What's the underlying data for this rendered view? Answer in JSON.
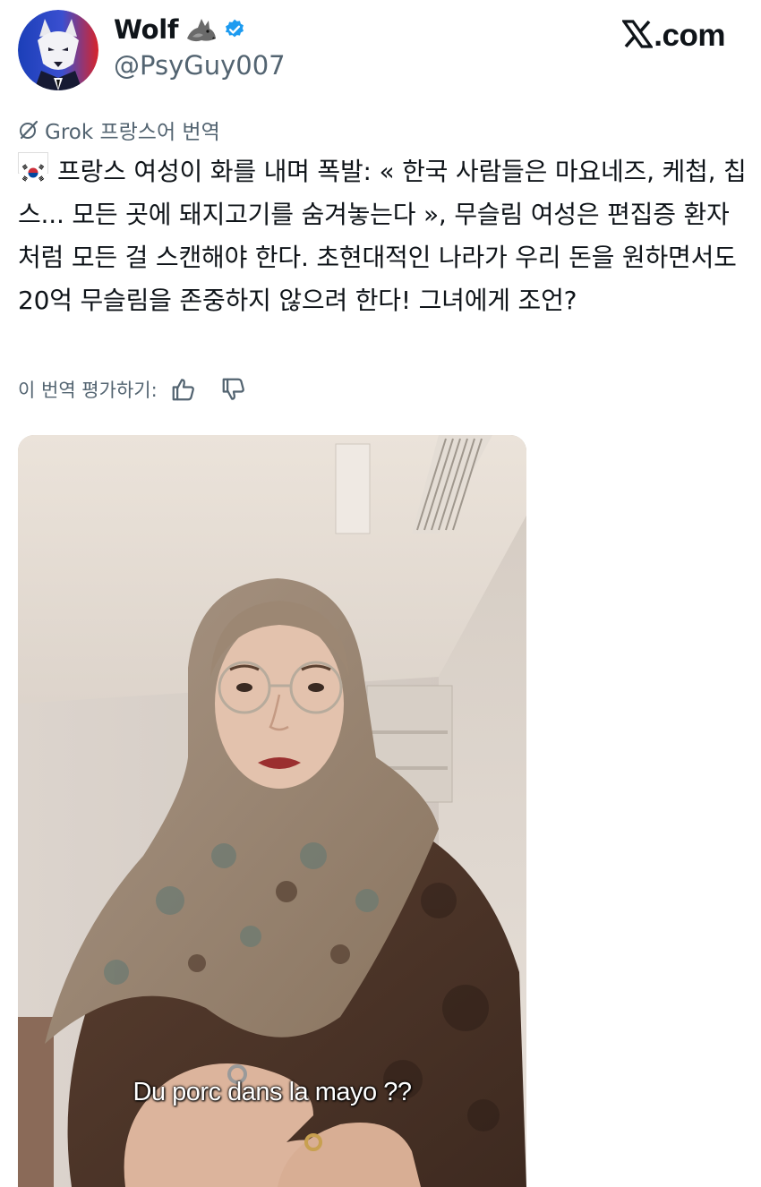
{
  "author": {
    "display_name": "Wolf",
    "handle": "@PsyGuy007",
    "verified": true,
    "name_emoji": "wolf-emoji",
    "badge_icon": "verified-badge-icon",
    "badge_color": "#1d9bf0"
  },
  "site_badge": {
    "label": ".com",
    "logo": "x-logo-icon"
  },
  "translation": {
    "icon": "grok-icon",
    "label": "Grok 프랑스어 번역"
  },
  "tweet": {
    "flag_icon": "south-korea-flag-icon",
    "text": "프랑스 여성이 화를 내며 폭발: « 한국 사람들은 마요네즈, 케첩, 칩스... 모든 곳에 돼지고기를 숨겨놓는다 », 무슬림 여성은 편집증 환자처럼 모든 걸 스캔해야 한다. 초현대적인 나라가 우리 돈을 원하면서도 20억 무슬림을 존중하지 않으려 한다! 그녀에게 조언?"
  },
  "rating": {
    "label": "이 번역 평가하기:",
    "thumbs_up_icon": "thumbs-up-icon",
    "thumbs_down_icon": "thumbs-down-icon"
  },
  "media": {
    "type": "video-thumbnail",
    "subtitle": "Du porc dans la mayo ??"
  },
  "colors": {
    "text_primary": "#0f1419",
    "text_secondary": "#536471",
    "accent": "#1d9bf0"
  }
}
